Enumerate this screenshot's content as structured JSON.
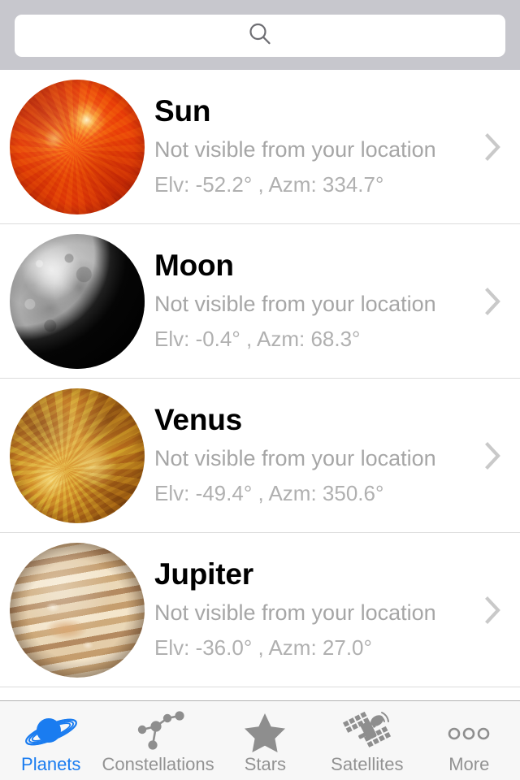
{
  "search": {
    "placeholder": "",
    "value": "",
    "icon": "search-icon"
  },
  "colors": {
    "accent": "#1a7cf0",
    "header_bg": "#c7c7cd",
    "tabbar_bg": "#f7f7f7",
    "title_text": "#000000",
    "subtitle_text": "#a6a6a6",
    "coords_text": "#b0b0b0",
    "tab_inactive": "#929292",
    "divider": "#dcdcdc"
  },
  "list": {
    "rows": [
      {
        "name": "Sun",
        "status": "Not visible from your location",
        "coords": "Elv: -52.2° ,  Azm: 334.7°",
        "elevation": "-52.2°",
        "azimuth": "334.7°",
        "thumb": "sun-thumbnail",
        "chevron": "chevron-right-icon"
      },
      {
        "name": "Moon",
        "status": "Not visible from your location",
        "coords": "Elv: -0.4° ,  Azm: 68.3°",
        "elevation": "-0.4°",
        "azimuth": "68.3°",
        "thumb": "moon-thumbnail",
        "chevron": "chevron-right-icon"
      },
      {
        "name": "Venus",
        "status": "Not visible from your location",
        "coords": "Elv: -49.4° ,  Azm: 350.6°",
        "elevation": "-49.4°",
        "azimuth": "350.6°",
        "thumb": "venus-thumbnail",
        "chevron": "chevron-right-icon"
      },
      {
        "name": "Jupiter",
        "status": "Not visible from your location",
        "coords": "Elv: -36.0° ,  Azm: 27.0°",
        "elevation": "-36.0°",
        "azimuth": "27.0°",
        "thumb": "jupiter-thumbnail",
        "chevron": "chevron-right-icon"
      }
    ]
  },
  "tabbar": {
    "active_index": 0,
    "tabs": [
      {
        "label": "Planets",
        "icon": "saturn-icon"
      },
      {
        "label": "Constellations",
        "icon": "constellation-icon"
      },
      {
        "label": "Stars",
        "icon": "star-icon"
      },
      {
        "label": "Satellites",
        "icon": "satellite-icon"
      },
      {
        "label": "More",
        "icon": "ellipsis-icon"
      }
    ]
  }
}
